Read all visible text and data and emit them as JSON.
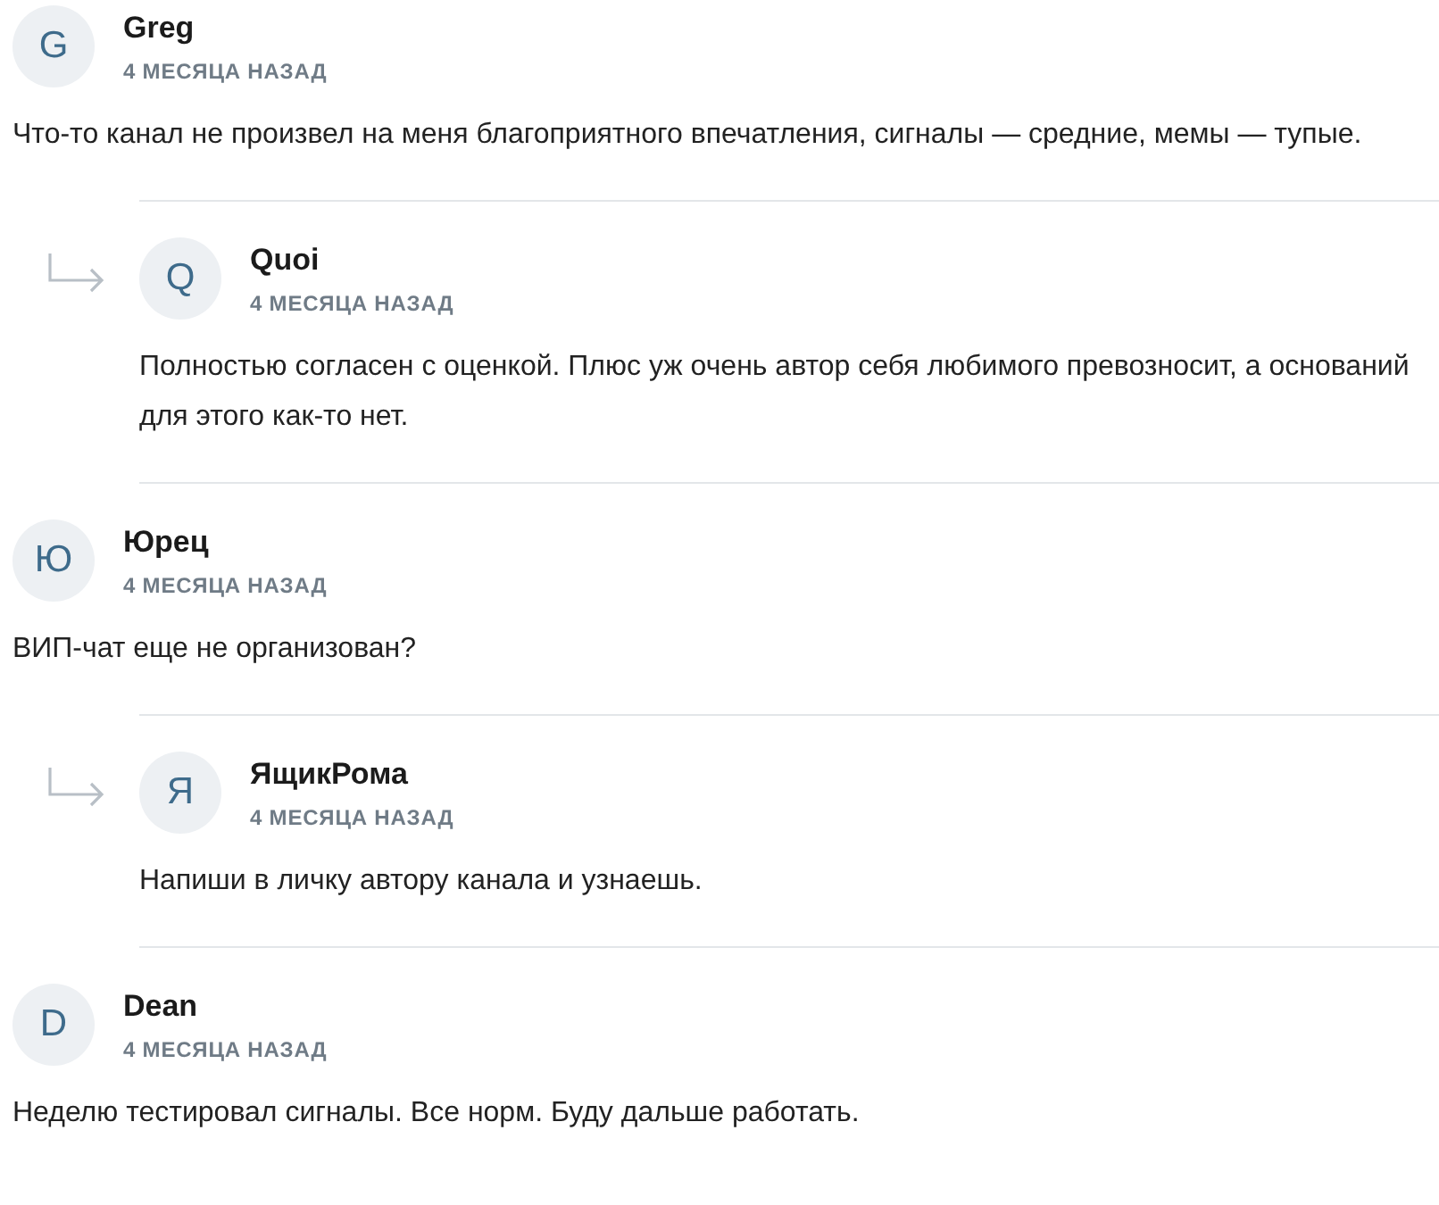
{
  "comments": [
    {
      "author": "Greg",
      "avatar": "G",
      "time": "4 МЕСЯЦА НАЗАД",
      "text": "Что-то канал не произвел на меня благоприятного впечатления, сигналы — средние, мемы — тупые.",
      "replies": [
        {
          "author": "Quoi",
          "avatar": "Q",
          "time": "4 МЕСЯЦА НАЗАД",
          "text": "Полностью согласен с оценкой. Плюс уж очень автор себя любимого превозносит, а оснований для этого как-то нет."
        }
      ]
    },
    {
      "author": "Юрец",
      "avatar": "Ю",
      "time": "4 МЕСЯЦА НАЗАД",
      "text": "ВИП-чат еще не организован?",
      "replies": [
        {
          "author": "ЯщикРома",
          "avatar": "Я",
          "time": "4 МЕСЯЦА НАЗАД",
          "text": "Напиши в личку автору канала и узнаешь."
        }
      ]
    },
    {
      "author": "Dean",
      "avatar": "D",
      "time": "4 МЕСЯЦА НАЗАД",
      "text": "Неделю тестировал сигналы. Все норм. Буду дальше работать."
    }
  ]
}
